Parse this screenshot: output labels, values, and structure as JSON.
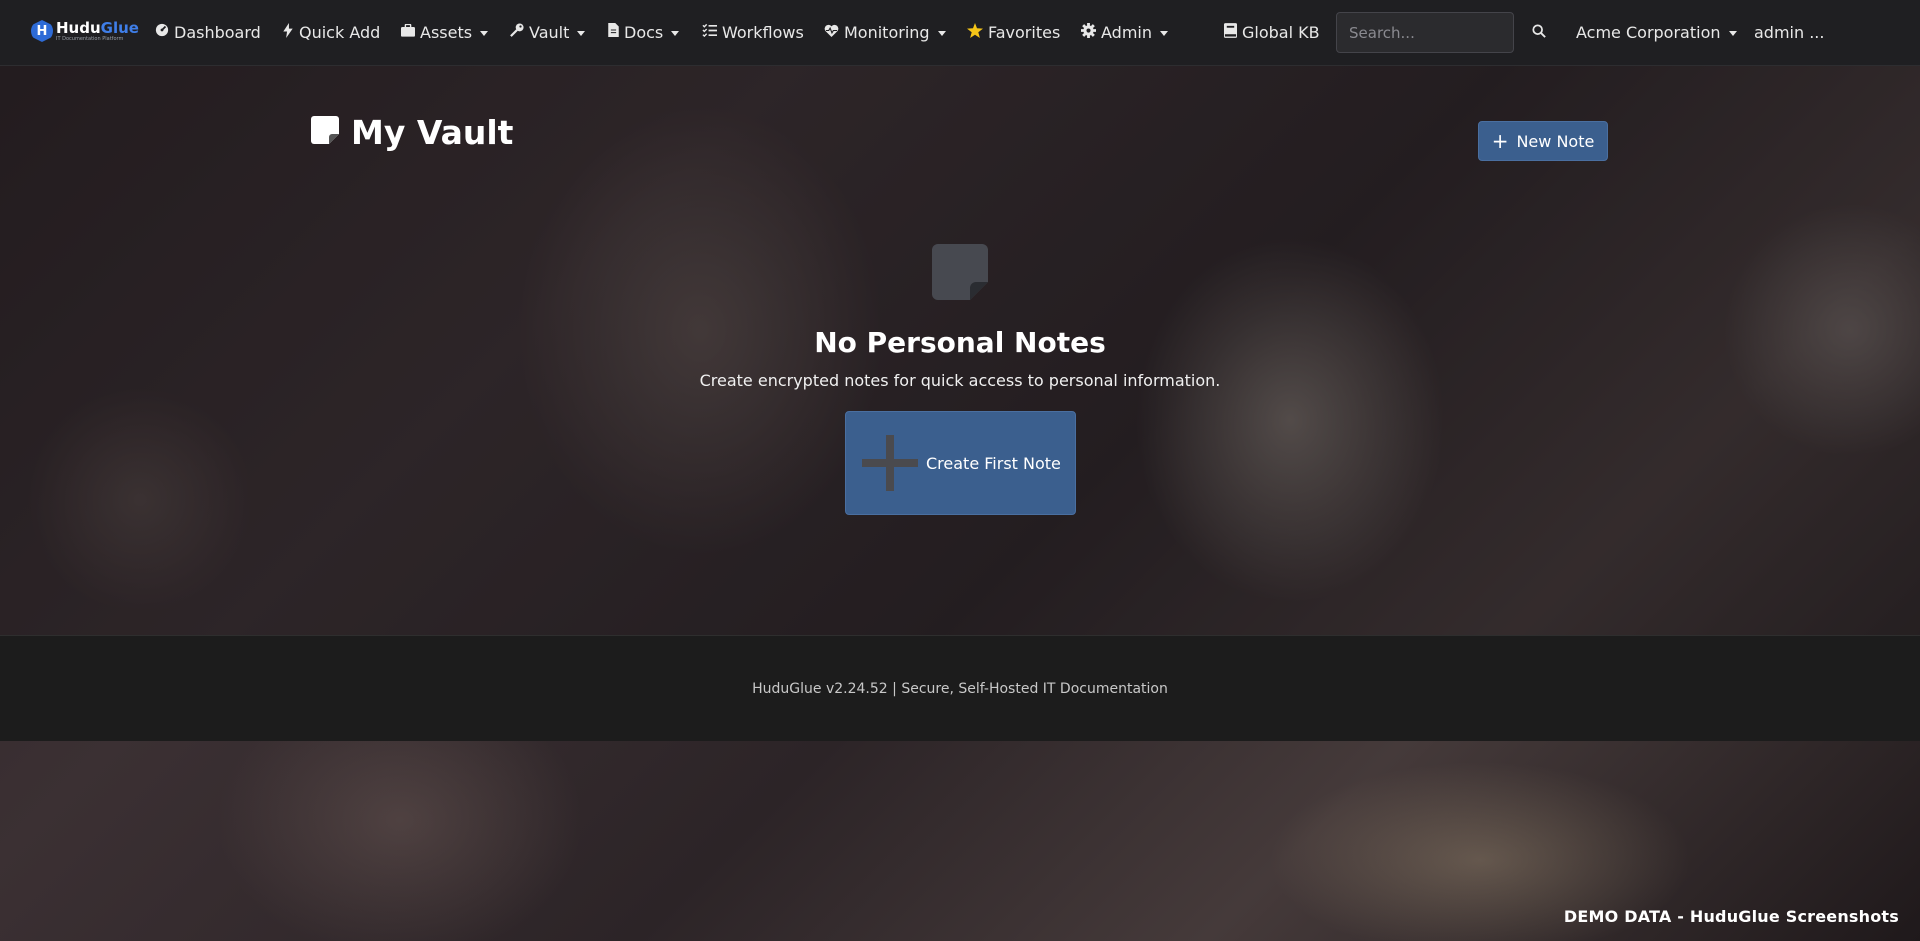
{
  "brand": {
    "name_part1": "Hudu",
    "name_part2": "Glue",
    "tagline": "IT Documentation Platform"
  },
  "nav": {
    "dashboard": "Dashboard",
    "quick_add": "Quick Add",
    "assets": "Assets",
    "vault": "Vault",
    "docs": "Docs",
    "workflows": "Workflows",
    "monitoring": "Monitoring",
    "favorites": "Favorites",
    "admin": "Admin",
    "global_kb": "Global KB",
    "search_placeholder": "Search...",
    "company": "Acme Corporation",
    "user": "admin ..."
  },
  "page": {
    "title": "My Vault",
    "new_note_label": "New Note"
  },
  "empty_state": {
    "title": "No Personal Notes",
    "description": "Create encrypted notes for quick access to personal information.",
    "button_label": "Create First Note"
  },
  "footer": {
    "text": "HuduGlue v2.24.52 | Secure, Self-Hosted IT Documentation"
  },
  "watermark": "DEMO DATA - HuduGlue Screenshots",
  "colors": {
    "navbar_bg": "#1f1f22",
    "primary_button": "#3b5f8e",
    "brand_blue": "#2e6bd6",
    "favorites_star": "#f5c518",
    "footer_bg": "#1c1c1c"
  }
}
